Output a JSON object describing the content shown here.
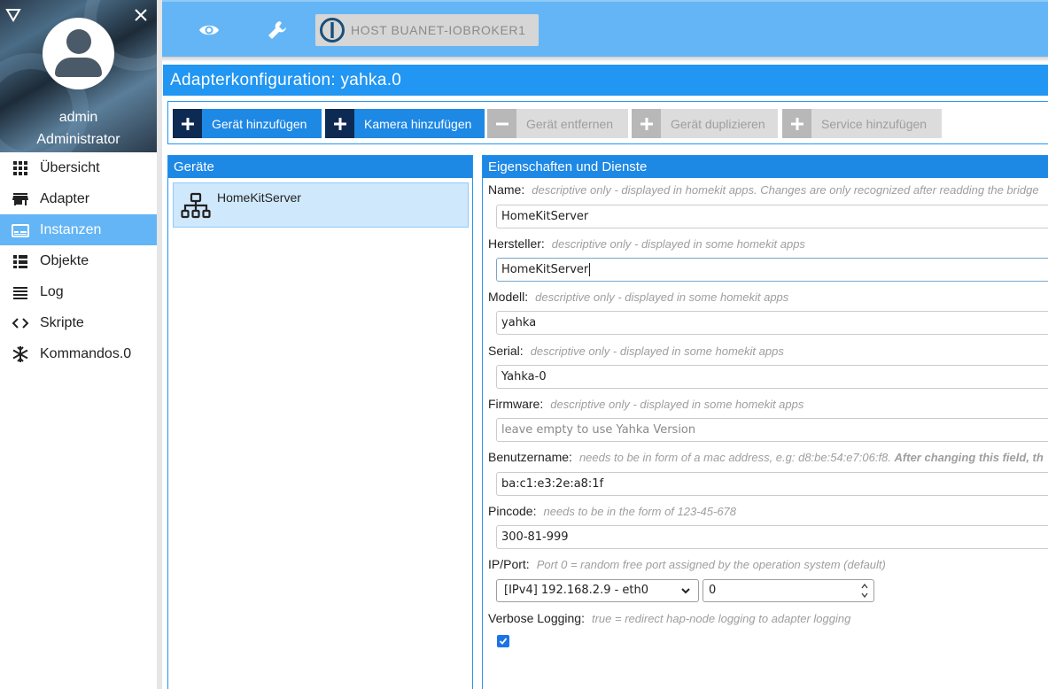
{
  "sidebar": {
    "user_name": "admin",
    "user_role": "Administrator",
    "items": [
      {
        "label": "Übersicht",
        "icon": "grid-icon"
      },
      {
        "label": "Adapter",
        "icon": "store-icon"
      },
      {
        "label": "Instanzen",
        "icon": "instances-icon",
        "active": true
      },
      {
        "label": "Objekte",
        "icon": "list-icon"
      },
      {
        "label": "Log",
        "icon": "log-icon"
      },
      {
        "label": "Skripte",
        "icon": "code-icon"
      },
      {
        "label": "Kommandos.0",
        "icon": "snowflake-icon"
      }
    ]
  },
  "topbar": {
    "host_label": "HOST BUANET-IOBROKER1",
    "host_icon": "iobroker-logo-icon"
  },
  "config": {
    "title": "Adapterkonfiguration: yahka.0"
  },
  "toolbar": {
    "add_device": "Gerät hinzufügen",
    "add_camera": "Kamera hinzufügen",
    "remove_device": "Gerät entfernen",
    "duplicate_device": "Gerät duplizieren",
    "add_service": "Service hinzufügen"
  },
  "devices": {
    "title": "Geräte",
    "items": [
      {
        "name": "HomeKitServer",
        "icon": "network-tree-icon"
      }
    ]
  },
  "properties": {
    "title": "Eigenschaften und Dienste",
    "name": {
      "label": "Name:",
      "hint": "descriptive only - displayed in homekit apps. Changes are only recognized after readding the bridge",
      "value": "HomeKitServer"
    },
    "manufacturer": {
      "label": "Hersteller:",
      "hint": "descriptive only - displayed in some homekit apps",
      "value": "HomeKitServer"
    },
    "model": {
      "label": "Modell:",
      "hint": "descriptive only - displayed in some homekit apps",
      "value": "yahka"
    },
    "serial": {
      "label": "Serial:",
      "hint": "descriptive only - displayed in some homekit apps",
      "value": "Yahka-0"
    },
    "firmware": {
      "label": "Firmware:",
      "hint": "descriptive only - displayed in some homekit apps",
      "placeholder": "leave empty to use Yahka Version"
    },
    "username": {
      "label": "Benutzername:",
      "hint": "needs to be in form of a mac address, e.g: d8:be:54:e7:06:f8.",
      "hint_bold": "After changing this field, th",
      "value": "ba:c1:e3:2e:a8:1f"
    },
    "pincode": {
      "label": "Pincode:",
      "hint": "needs to be in the form of 123-45-678",
      "value": "300-81-999"
    },
    "ipport": {
      "label": "IP/Port:",
      "hint": "Port 0 = random free port assigned by the operation system (default)",
      "ip_value": "[IPv4] 192.168.2.9 - eth0",
      "port_value": "0"
    },
    "verbose": {
      "label": "Verbose Logging:",
      "hint": "true = redirect hap-node logging to adapter logging",
      "checked": true
    }
  },
  "colors": {
    "topbar": "#64b5f6",
    "primary": "#2196f3",
    "toolbar_icon_bg": "#0d2a52",
    "active_nav": "#64b5f6"
  }
}
